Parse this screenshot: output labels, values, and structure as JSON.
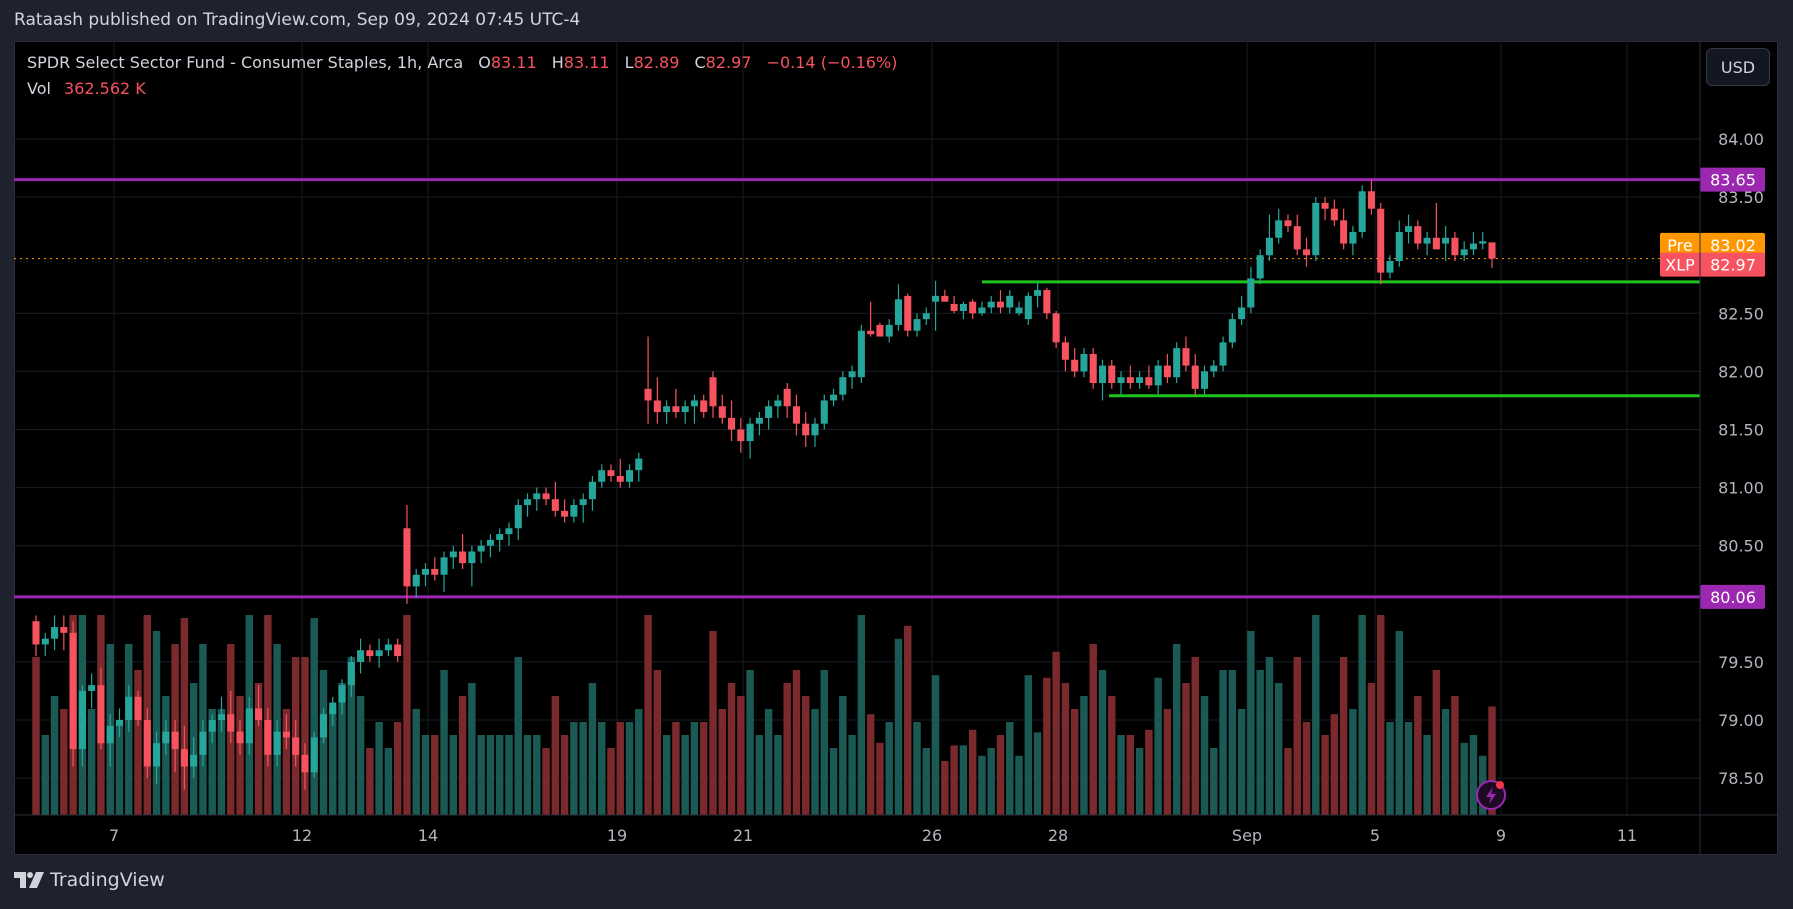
{
  "header": {
    "publish_text": "Rataash published on TradingView.com, Sep 09, 2024 07:45 UTC-4"
  },
  "legend": {
    "title": "SPDR Select Sector Fund - Consumer Staples, 1h, Arca",
    "o_label": "O",
    "o": "83.11",
    "h_label": "H",
    "h": "83.11",
    "l_label": "L",
    "l": "82.89",
    "c_label": "C",
    "c": "82.97",
    "change": "−0.14 (−0.16%)",
    "vol_label": "Vol",
    "vol": "362.562 K"
  },
  "currency_button": "USD",
  "footer": {
    "brand": "TradingView"
  },
  "colors": {
    "up": "#26a69a",
    "down": "#f7525f",
    "vol_up": "#1b5a54",
    "vol_down": "#7a2a2c",
    "level_purple": "#9c27b0",
    "level_green": "#1ec31e",
    "pre": "#ff9800",
    "last": "#f7525f"
  },
  "chart_data": {
    "type": "candlestick",
    "title": "SPDR Select Sector Fund - Consumer Staples, 1h, Arca",
    "symbol": "XLP",
    "timeframe": "1h",
    "ylim": [
      78.2,
      84.6
    ],
    "y_ticks": [
      "84.00",
      "83.50",
      "82.50",
      "82.00",
      "81.50",
      "81.00",
      "80.50",
      "79.50",
      "79.00",
      "78.50"
    ],
    "x_ticks": [
      "7",
      "12",
      "14",
      "19",
      "21",
      "26",
      "28",
      "Sep",
      "5",
      "9",
      "11"
    ],
    "grid": true,
    "horizontal_levels": [
      {
        "label": "83.65",
        "value": 83.65,
        "color": "purple"
      },
      {
        "label": "80.06",
        "value": 80.06,
        "color": "purple"
      },
      {
        "label": "",
        "value": 82.77,
        "color": "green",
        "from": "Aug 27"
      },
      {
        "label": "",
        "value": 81.79,
        "color": "green",
        "from": "Aug 29"
      }
    ],
    "price_labels": [
      {
        "tag": "Pre",
        "value": "83.02",
        "color": "orange"
      },
      {
        "tag": "XLP",
        "value": "82.97",
        "color": "red"
      }
    ],
    "candles_ohlc": [
      [
        79.85,
        79.9,
        79.55,
        79.65
      ],
      [
        79.65,
        79.75,
        79.55,
        79.7
      ],
      [
        79.7,
        79.9,
        79.6,
        79.8
      ],
      [
        79.8,
        79.9,
        79.6,
        79.75
      ],
      [
        79.75,
        79.85,
        78.6,
        78.75
      ],
      [
        78.75,
        79.3,
        78.6,
        79.25
      ],
      [
        79.25,
        79.4,
        79.1,
        79.3
      ],
      [
        79.3,
        79.45,
        78.75,
        78.8
      ],
      [
        78.8,
        79.05,
        78.6,
        78.95
      ],
      [
        78.95,
        79.1,
        78.85,
        79.0
      ],
      [
        79.0,
        79.3,
        78.9,
        79.2
      ],
      [
        79.2,
        79.25,
        78.95,
        79.0
      ],
      [
        79.0,
        79.1,
        78.5,
        78.6
      ],
      [
        78.6,
        78.9,
        78.45,
        78.8
      ],
      [
        78.8,
        79.0,
        78.7,
        78.9
      ],
      [
        78.9,
        79.0,
        78.55,
        78.75
      ],
      [
        78.75,
        78.95,
        78.4,
        78.6
      ],
      [
        78.6,
        78.85,
        78.5,
        78.7
      ],
      [
        78.7,
        79.0,
        78.6,
        78.9
      ],
      [
        78.9,
        79.05,
        78.8,
        79.0
      ],
      [
        79.0,
        79.2,
        78.9,
        79.05
      ],
      [
        79.05,
        79.25,
        78.8,
        78.9
      ],
      [
        78.9,
        79.0,
        78.7,
        78.8
      ],
      [
        78.8,
        79.2,
        78.7,
        79.1
      ],
      [
        79.1,
        79.3,
        78.95,
        79.0
      ],
      [
        79.0,
        79.1,
        78.6,
        78.7
      ],
      [
        78.7,
        79.0,
        78.6,
        78.9
      ],
      [
        78.9,
        79.05,
        78.75,
        78.85
      ],
      [
        78.85,
        79.0,
        78.6,
        78.7
      ],
      [
        78.7,
        78.8,
        78.4,
        78.55
      ],
      [
        78.55,
        78.9,
        78.5,
        78.85
      ],
      [
        78.85,
        79.1,
        78.8,
        79.05
      ],
      [
        79.05,
        79.2,
        78.95,
        79.15
      ],
      [
        79.15,
        79.35,
        79.05,
        79.3
      ],
      [
        79.3,
        79.55,
        79.2,
        79.5
      ],
      [
        79.5,
        79.7,
        79.4,
        79.6
      ],
      [
        79.6,
        79.65,
        79.5,
        79.55
      ],
      [
        79.55,
        79.7,
        79.45,
        79.6
      ],
      [
        79.6,
        79.7,
        79.55,
        79.65
      ],
      [
        79.65,
        79.7,
        79.5,
        79.55
      ],
      [
        80.65,
        80.85,
        80.0,
        80.15
      ],
      [
        80.15,
        80.3,
        80.05,
        80.25
      ],
      [
        80.25,
        80.35,
        80.15,
        80.3
      ],
      [
        80.3,
        80.4,
        80.2,
        80.25
      ],
      [
        80.25,
        80.45,
        80.1,
        80.4
      ],
      [
        80.4,
        80.5,
        80.3,
        80.45
      ],
      [
        80.45,
        80.6,
        80.3,
        80.35
      ],
      [
        80.35,
        80.5,
        80.15,
        80.45
      ],
      [
        80.45,
        80.55,
        80.35,
        80.5
      ],
      [
        80.5,
        80.6,
        80.4,
        80.55
      ],
      [
        80.55,
        80.65,
        80.45,
        80.6
      ],
      [
        80.6,
        80.7,
        80.5,
        80.65
      ],
      [
        80.65,
        80.9,
        80.55,
        80.85
      ],
      [
        80.85,
        80.95,
        80.75,
        80.9
      ],
      [
        80.9,
        81.0,
        80.8,
        80.95
      ],
      [
        80.95,
        81.0,
        80.85,
        80.9
      ],
      [
        80.9,
        81.05,
        80.75,
        80.8
      ],
      [
        80.8,
        80.9,
        80.7,
        80.75
      ],
      [
        80.75,
        80.9,
        80.7,
        80.85
      ],
      [
        80.85,
        80.95,
        80.7,
        80.9
      ],
      [
        80.9,
        81.1,
        80.8,
        81.05
      ],
      [
        81.05,
        81.2,
        81.0,
        81.15
      ],
      [
        81.15,
        81.2,
        81.05,
        81.1
      ],
      [
        81.1,
        81.25,
        81.0,
        81.05
      ],
      [
        81.05,
        81.2,
        81.0,
        81.15
      ],
      [
        81.15,
        81.3,
        81.05,
        81.25
      ],
      [
        81.85,
        82.3,
        81.55,
        81.75
      ],
      [
        81.75,
        81.95,
        81.55,
        81.65
      ],
      [
        81.65,
        81.75,
        81.55,
        81.7
      ],
      [
        81.7,
        81.85,
        81.6,
        81.65
      ],
      [
        81.65,
        81.75,
        81.55,
        81.7
      ],
      [
        81.7,
        81.8,
        81.55,
        81.75
      ],
      [
        81.75,
        81.8,
        81.6,
        81.65
      ],
      [
        81.95,
        82.0,
        81.6,
        81.7
      ],
      [
        81.7,
        81.8,
        81.55,
        81.6
      ],
      [
        81.6,
        81.75,
        81.4,
        81.5
      ],
      [
        81.5,
        81.6,
        81.3,
        81.4
      ],
      [
        81.4,
        81.6,
        81.25,
        81.55
      ],
      [
        81.55,
        81.65,
        81.45,
        81.6
      ],
      [
        81.6,
        81.75,
        81.5,
        81.7
      ],
      [
        81.7,
        81.8,
        81.6,
        81.75
      ],
      [
        81.85,
        81.9,
        81.6,
        81.7
      ],
      [
        81.7,
        81.8,
        81.45,
        81.55
      ],
      [
        81.55,
        81.65,
        81.35,
        81.45
      ],
      [
        81.45,
        81.6,
        81.35,
        81.55
      ],
      [
        81.55,
        81.8,
        81.5,
        81.75
      ],
      [
        81.75,
        81.85,
        81.7,
        81.8
      ],
      [
        81.8,
        82.0,
        81.75,
        81.95
      ],
      [
        81.95,
        82.05,
        81.85,
        82.0
      ],
      [
        81.95,
        82.4,
        81.9,
        82.35
      ],
      [
        82.35,
        82.6,
        82.3,
        82.32
      ],
      [
        82.4,
        82.42,
        82.3,
        82.3
      ],
      [
        82.3,
        82.45,
        82.25,
        82.4
      ],
      [
        82.4,
        82.75,
        82.35,
        82.62
      ],
      [
        82.65,
        82.67,
        82.3,
        82.35
      ],
      [
        82.35,
        82.5,
        82.3,
        82.45
      ],
      [
        82.45,
        82.55,
        82.4,
        82.5
      ],
      [
        82.6,
        82.78,
        82.35,
        82.65
      ],
      [
        82.65,
        82.7,
        82.6,
        82.6
      ],
      [
        82.58,
        82.65,
        82.5,
        82.52
      ],
      [
        82.52,
        82.6,
        82.45,
        82.58
      ],
      [
        82.6,
        82.62,
        82.45,
        82.5
      ],
      [
        82.5,
        82.6,
        82.48,
        82.55
      ],
      [
        82.55,
        82.65,
        82.5,
        82.6
      ],
      [
        82.6,
        82.7,
        82.5,
        82.55
      ],
      [
        82.55,
        82.7,
        82.5,
        82.65
      ],
      [
        82.5,
        82.6,
        82.48,
        82.55
      ],
      [
        82.45,
        82.68,
        82.4,
        82.65
      ],
      [
        82.65,
        82.76,
        82.55,
        82.7
      ],
      [
        82.7,
        82.72,
        82.45,
        82.5
      ],
      [
        82.5,
        82.52,
        82.2,
        82.25
      ],
      [
        82.25,
        82.3,
        82.0,
        82.1
      ],
      [
        82.1,
        82.2,
        81.95,
        82.0
      ],
      [
        82.0,
        82.2,
        81.95,
        82.15
      ],
      [
        82.15,
        82.2,
        81.85,
        81.9
      ],
      [
        81.9,
        82.1,
        81.75,
        82.05
      ],
      [
        82.05,
        82.1,
        81.85,
        81.9
      ],
      [
        81.9,
        82.0,
        81.8,
        81.95
      ],
      [
        81.95,
        82.05,
        81.85,
        81.9
      ],
      [
        81.9,
        82.0,
        81.85,
        81.95
      ],
      [
        81.95,
        82.05,
        81.85,
        81.88
      ],
      [
        81.88,
        82.1,
        81.8,
        82.05
      ],
      [
        82.05,
        82.15,
        81.9,
        81.95
      ],
      [
        81.95,
        82.25,
        81.9,
        82.2
      ],
      [
        82.2,
        82.3,
        82.0,
        82.05
      ],
      [
        82.05,
        82.15,
        81.8,
        81.85
      ],
      [
        81.85,
        82.05,
        81.8,
        82.0
      ],
      [
        82.0,
        82.1,
        81.95,
        82.05
      ],
      [
        82.05,
        82.3,
        82.0,
        82.25
      ],
      [
        82.25,
        82.5,
        82.2,
        82.45
      ],
      [
        82.45,
        82.65,
        82.4,
        82.55
      ],
      [
        82.55,
        82.9,
        82.5,
        82.8
      ],
      [
        82.8,
        83.05,
        82.75,
        83.0
      ],
      [
        83.0,
        83.35,
        82.95,
        83.15
      ],
      [
        83.15,
        83.4,
        83.1,
        83.3
      ],
      [
        83.3,
        83.35,
        83.2,
        83.25
      ],
      [
        83.25,
        83.35,
        83.0,
        83.05
      ],
      [
        83.05,
        83.15,
        82.9,
        83.0
      ],
      [
        83.0,
        83.5,
        82.95,
        83.45
      ],
      [
        83.45,
        83.5,
        83.3,
        83.4
      ],
      [
        83.4,
        83.48,
        83.25,
        83.3
      ],
      [
        83.3,
        83.4,
        83.05,
        83.1
      ],
      [
        83.1,
        83.25,
        83.0,
        83.2
      ],
      [
        83.2,
        83.6,
        83.15,
        83.55
      ],
      [
        83.55,
        83.65,
        83.35,
        83.4
      ],
      [
        83.4,
        83.45,
        82.75,
        82.85
      ],
      [
        82.85,
        83.0,
        82.8,
        82.95
      ],
      [
        82.95,
        83.3,
        82.9,
        83.2
      ],
      [
        83.2,
        83.35,
        83.1,
        83.25
      ],
      [
        83.25,
        83.3,
        83.05,
        83.1
      ],
      [
        83.1,
        83.2,
        83.0,
        83.15
      ],
      [
        83.15,
        83.45,
        83.05,
        83.05
      ],
      [
        83.1,
        83.25,
        82.95,
        83.15
      ],
      [
        83.15,
        83.2,
        82.95,
        83.0
      ],
      [
        83.0,
        83.12,
        82.95,
        83.05
      ],
      [
        83.05,
        83.2,
        83.0,
        83.1
      ],
      [
        83.1,
        83.2,
        83.05,
        83.12
      ],
      [
        83.11,
        83.11,
        82.89,
        82.97
      ]
    ]
  }
}
